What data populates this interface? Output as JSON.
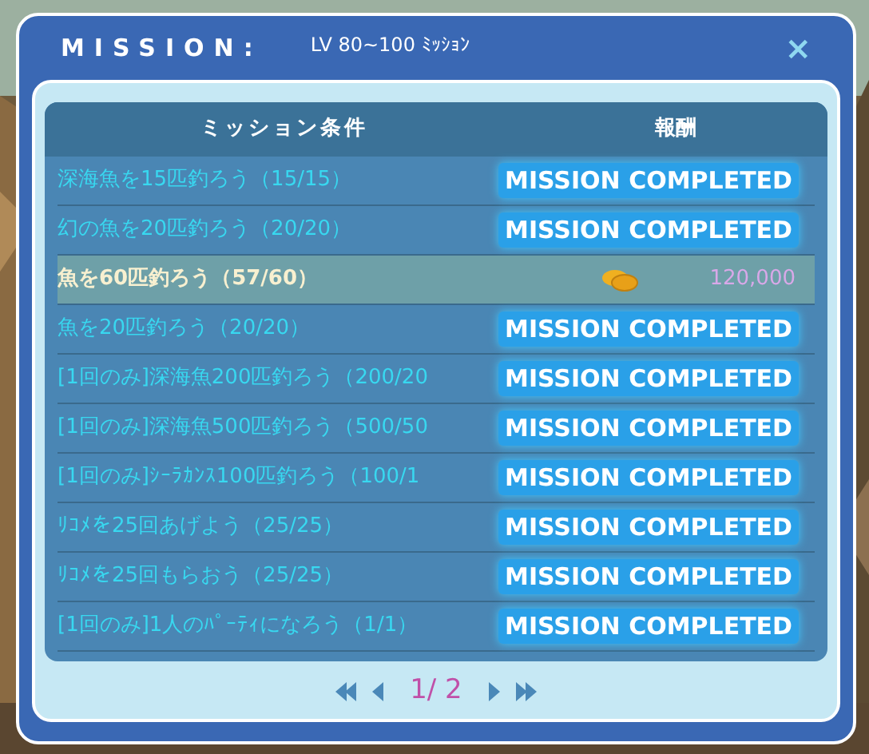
{
  "window": {
    "title": "MISSION:",
    "subtitle": "LV 80~100 ﾐｯｼｮﾝ",
    "close": "×"
  },
  "table": {
    "columns": [
      "ミッション条件",
      "報酬"
    ],
    "rows": [
      {
        "condition": "深海魚を15匹釣ろう（15/15）",
        "completed": true,
        "status": "MISSION COMPLETED"
      },
      {
        "condition": "幻の魚を20匹釣ろう（20/20）",
        "completed": true,
        "status": "MISSION COMPLETED"
      },
      {
        "condition": "魚を60匹釣ろう（57/60）",
        "completed": false,
        "reward": "120,000"
      },
      {
        "condition": "魚を20匹釣ろう（20/20）",
        "completed": true,
        "status": "MISSION COMPLETED"
      },
      {
        "condition": "[1回のみ]深海魚200匹釣ろう（200/20",
        "completed": true,
        "status": "MISSION COMPLETED"
      },
      {
        "condition": "[1回のみ]深海魚500匹釣ろう（500/50",
        "completed": true,
        "status": "MISSION COMPLETED"
      },
      {
        "condition": "[1回のみ]ｼｰﾗｶﾝｽ100匹釣ろう（100/1",
        "completed": true,
        "status": "MISSION COMPLETED"
      },
      {
        "condition": "ﾘｺﾒを25回あげよう（25/25）",
        "completed": true,
        "status": "MISSION COMPLETED"
      },
      {
        "condition": "ﾘｺﾒを25回もらおう（25/25）",
        "completed": true,
        "status": "MISSION COMPLETED"
      },
      {
        "condition": "[1回のみ]1人のﾊﾟｰﾃｨになろう（1/1）",
        "completed": true,
        "status": "MISSION COMPLETED"
      }
    ]
  },
  "pagination": {
    "page": "1/ 2"
  }
}
